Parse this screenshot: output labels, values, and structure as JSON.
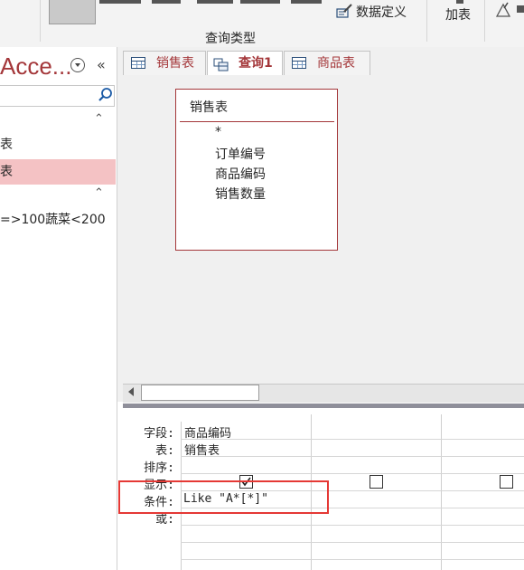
{
  "ribbon": {
    "data_definition_label": "数据定义",
    "query_type_group": "查询类型",
    "add_table_label": "加表"
  },
  "nav": {
    "title": "Acce...",
    "items": [
      {
        "label": "表"
      },
      {
        "label": "表",
        "selected": true
      },
      {
        "label": "=>100蔬菜<200"
      }
    ]
  },
  "tabs": [
    {
      "label": "销售表",
      "icon": "table-icon",
      "active": false
    },
    {
      "label": "查询1",
      "icon": "query-icon",
      "active": true
    },
    {
      "label": "商品表",
      "icon": "table-icon",
      "active": false
    }
  ],
  "field_list": {
    "table_name": "销售表",
    "fields": [
      "*",
      "订单编号",
      "商品编码",
      "销售数量"
    ]
  },
  "grid": {
    "row_labels": {
      "field": "字段:",
      "table": "表:",
      "sort": "排序:",
      "show": "显示:",
      "criteria": "条件:",
      "or": "或:"
    },
    "columns": [
      {
        "field": "商品编码",
        "table": "销售表",
        "show": true,
        "criteria": "Like \"A*[*]\""
      },
      {
        "field": "",
        "table": "",
        "show": false,
        "criteria": ""
      },
      {
        "field": "",
        "table": "",
        "show": false,
        "criteria": ""
      }
    ]
  },
  "colors": {
    "accent": "#a4373a",
    "selection": "#f4c2c4",
    "highlight_box": "#e53935"
  }
}
